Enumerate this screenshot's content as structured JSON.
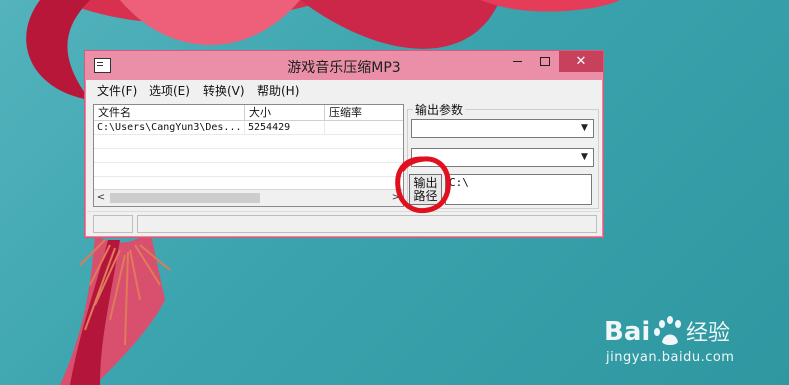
{
  "window": {
    "title": "游戏音乐压缩MP3",
    "controls": {
      "minimize": "minimize",
      "maximize": "maximize",
      "close": "✕"
    }
  },
  "menu": [
    "文件(F)",
    "选项(E)",
    "转换(V)",
    "帮助(H)"
  ],
  "file_list": {
    "columns": [
      "文件名",
      "大小",
      "压缩率"
    ],
    "rows": [
      {
        "name": "C:\\Users\\CangYun3\\Des...",
        "size": "5254429",
        "ratio": ""
      }
    ]
  },
  "output_params": {
    "group_label": "输出参数",
    "combo1_value": "",
    "combo2_value": "",
    "output_path_button": "输出\n路径",
    "output_path_button_line1": "输出",
    "output_path_button_line2": "路径",
    "output_path_value": "C:\\"
  },
  "scrollbar": {
    "left_arrow": "<",
    "right_arrow": ">"
  },
  "watermark": {
    "text": "jingyan.baidu.com",
    "brand": "Bai 经验"
  },
  "colors": {
    "titlebar": "#ea8fa7",
    "close_button": "#c7405c",
    "annotation": "#e0101e"
  }
}
